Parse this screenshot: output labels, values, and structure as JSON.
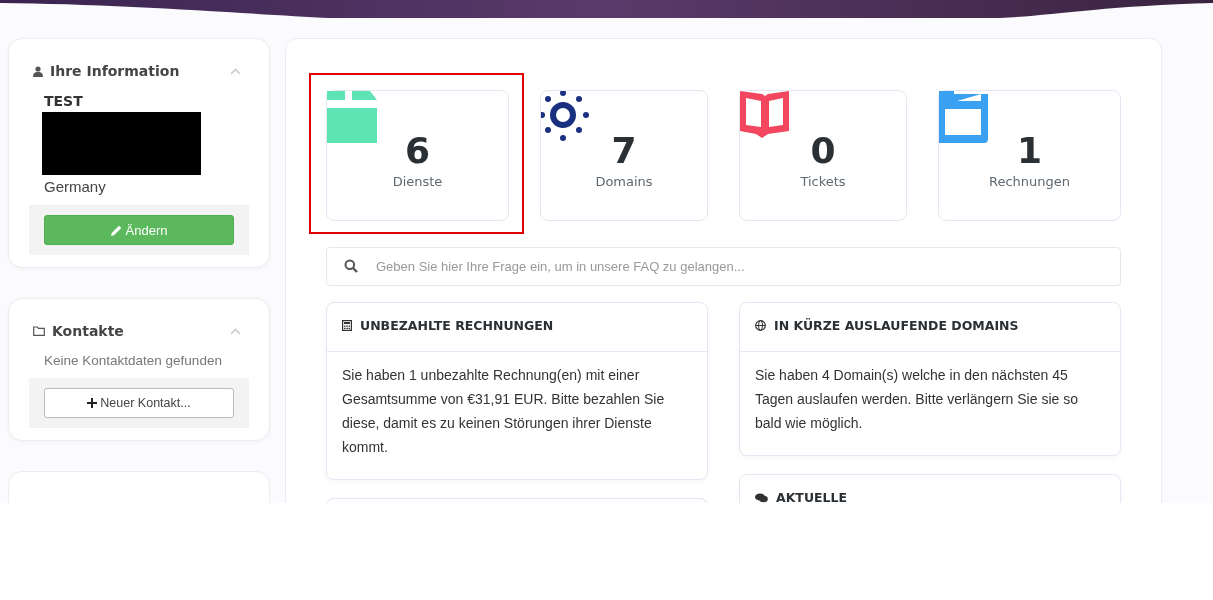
{
  "sidebar": {
    "info_card": {
      "title": "Ihre Information",
      "name": "TEST",
      "country": "Germany",
      "button": "Ändern"
    },
    "contacts_card": {
      "title": "Kontakte",
      "empty_text": "Keine Kontaktdaten gefunden",
      "button": "Neuer Kontakt..."
    }
  },
  "stats": [
    {
      "kind": "box",
      "value": "6",
      "label": "Dienste",
      "color": "#5ee3b5",
      "highlighted": true
    },
    {
      "kind": "sun",
      "value": "7",
      "label": "Domains",
      "color": "#1b2f80",
      "highlighted": false
    },
    {
      "kind": "book",
      "value": "0",
      "label": "Tickets",
      "color": "#f2475f",
      "highlighted": false
    },
    {
      "kind": "folder",
      "value": "1",
      "label": "Rechnungen",
      "color": "#3aa0f2",
      "highlighted": false
    }
  ],
  "search": {
    "placeholder": "Geben Sie hier Ihre Frage ein, um in unsere FAQ zu gelangen..."
  },
  "left_panels": [
    {
      "kind": "calculator",
      "title": "UNBEZAHLTE RECHNUNGEN",
      "body": "Sie haben 1 unbezahlte Rechnung(en) mit einer Gesamtsumme von €31,91 EUR. Bitte bezahlen Sie diese, damit es zu keinen Störungen ihrer Dienste kommt."
    }
  ],
  "right_panels": [
    {
      "kind": "globe",
      "title": "IN KÜRZE AUSLAUFENDE DOMAINS",
      "body": "Sie haben 4 Domain(s) welche in den nächsten 45 Tagen auslaufen werden. Bitte verlängern Sie sie so bald wie möglich."
    },
    {
      "kind": "comments",
      "title": "AKTUELLE"
    }
  ]
}
